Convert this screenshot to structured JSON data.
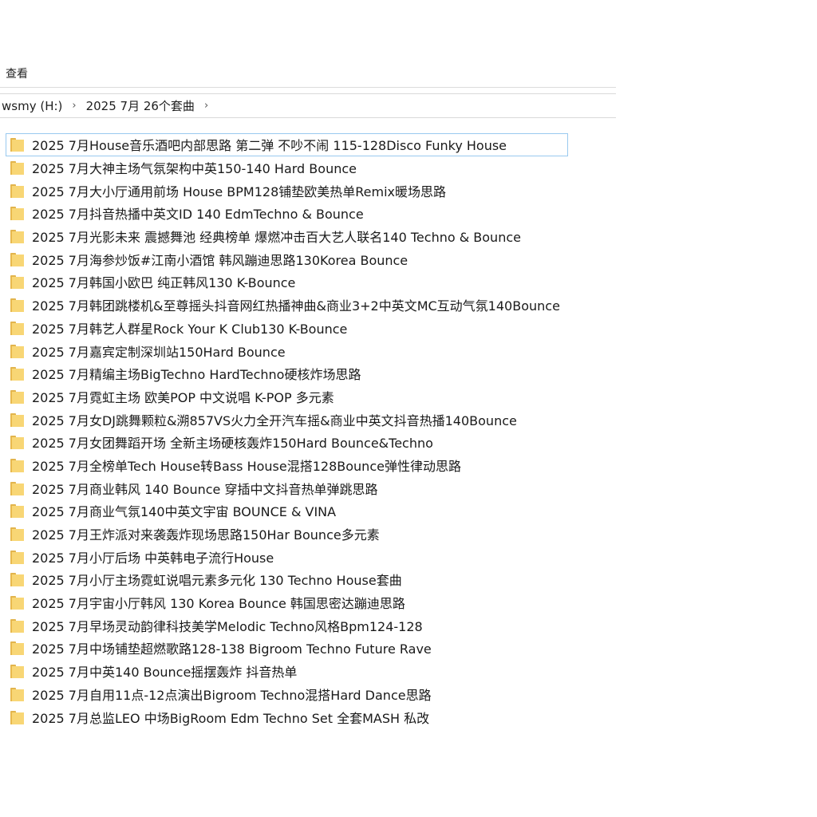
{
  "ribbon": {
    "tab_label": "查看"
  },
  "address_bar": {
    "crumbs": [
      "wsmy (H:)",
      "2025 7月 26个套曲"
    ]
  },
  "folders": [
    "2025 7月House音乐酒吧内部思路 第二弹 不吵不闹 115-128Disco Funky House",
    "2025 7月大神主场气氛架构中英150-140 Hard Bounce",
    "2025 7月大小厅通用前场 House BPM128铺垫欧美热单Remix暖场思路",
    "2025 7月抖音热播中英文ID 140 EdmTechno & Bounce",
    "2025 7月光影未来 震撼舞池 经典榜单 爆燃冲击百大艺人联名140 Techno & Bounce",
    "2025 7月海参炒饭#江南小酒馆 韩风蹦迪思路130Korea Bounce",
    "2025 7月韩国小欧巴 纯正韩风130 K-Bounce",
    "2025 7月韩团跳楼机&至尊摇头抖音网红热播神曲&商业3+2中英文MC互动气氛140Bounce",
    "2025 7月韩艺人群星Rock Your K Club130 K-Bounce",
    "2025 7月嘉宾定制深圳站150Hard Bounce",
    "2025 7月精编主场BigTechno HardTechno硬核炸场思路",
    "2025 7月霓虹主场 欧美POP 中文说唱 K-POP 多元素",
    "2025 7月女DJ跳舞颗粒&溯857VS火力全开汽车摇&商业中英文抖音热播140Bounce",
    "2025 7月女团舞蹈开场 全新主场硬核轰炸150Hard Bounce&Techno",
    "2025 7月全榜单Tech House转Bass House混搭128Bounce弹性律动思路",
    "2025 7月商业韩风 140 Bounce 穿插中文抖音热单弹跳思路",
    "2025 7月商业气氛140中英文宇宙 BOUNCE & VINA",
    "2025 7月王炸派对来袭轰炸现场思路150Har Bounce多元素",
    "2025 7月小厅后场 中英韩电子流行House",
    "2025 7月小厅主场霓虹说唱元素多元化 130 Techno House套曲",
    "2025 7月宇宙小厅韩风 130 Korea Bounce 韩国思密达蹦迪思路",
    "2025 7月早场灵动韵律科技美学Melodic Techno风格Bpm124-128",
    "2025 7月中场铺垫超燃歌路128-138 Bigroom Techno Future Rave",
    "2025 7月中英140 Bounce摇摆轰炸 抖音热单",
    "2025 7月自用11点-12点演出Bigroom Techno混搭Hard Dance思路",
    "2025 7月总监LEO 中场BigRoom Edm Techno Set 全套MASH 私改"
  ]
}
